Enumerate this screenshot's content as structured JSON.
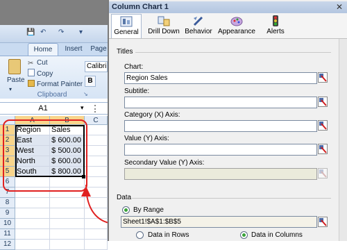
{
  "excel": {
    "ribbon_tabs": [
      "Home",
      "Insert",
      "Page"
    ],
    "quick_access": [
      "💾",
      "↶",
      "↷",
      "▾"
    ],
    "clipboard": {
      "paste_label": "Paste",
      "cut_label": "Cut",
      "copy_label": "Copy",
      "format_painter_label": "Format Painter",
      "group_label": "Clipboard"
    },
    "font_name": "Calibri",
    "bold_label": "B",
    "name_box": "A1",
    "columns": [
      "A",
      "B",
      "C"
    ],
    "rows": [
      {
        "num": "1",
        "a": "Region",
        "b": "Sales"
      },
      {
        "num": "2",
        "a": "East",
        "b": "$ 600.00"
      },
      {
        "num": "3",
        "a": "West",
        "b": "$ 500.00"
      },
      {
        "num": "4",
        "a": "North",
        "b": "$ 600.00"
      },
      {
        "num": "5",
        "a": "South",
        "b": "$ 800.00"
      },
      {
        "num": "6",
        "a": "",
        "b": ""
      },
      {
        "num": "7",
        "a": "",
        "b": ""
      },
      {
        "num": "8",
        "a": "",
        "b": ""
      },
      {
        "num": "9",
        "a": "",
        "b": ""
      },
      {
        "num": "10",
        "a": "",
        "b": ""
      },
      {
        "num": "11",
        "a": "",
        "b": ""
      },
      {
        "num": "12",
        "a": "",
        "b": ""
      }
    ],
    "annotation_color": "#e02020"
  },
  "dialog": {
    "title": "Column Chart 1",
    "close_glyph": "✕",
    "tabs": [
      {
        "label": "General",
        "icon": "general-icon"
      },
      {
        "label": "Drill Down",
        "icon": "drill-down-icon"
      },
      {
        "label": "Behavior",
        "icon": "behavior-icon"
      },
      {
        "label": "Appearance",
        "icon": "appearance-icon"
      },
      {
        "label": "Alerts",
        "icon": "alerts-icon"
      }
    ],
    "titles_section": "Titles",
    "fields": {
      "chart_label": "Chart:",
      "chart_value": "Region Sales",
      "subtitle_label": "Subtitle:",
      "subtitle_value": "",
      "x_axis_label": "Category (X) Axis:",
      "x_axis_value": "",
      "y_axis_label": "Value (Y) Axis:",
      "y_axis_value": "",
      "y2_axis_label": "Secondary Value (Y) Axis:",
      "y2_axis_value": ""
    },
    "data_section": "Data",
    "by_range_label": "By Range",
    "range_value": "Sheet1!$A$1:$B$5",
    "data_in_rows_label": "Data in Rows",
    "data_in_columns_label": "Data in Columns"
  }
}
